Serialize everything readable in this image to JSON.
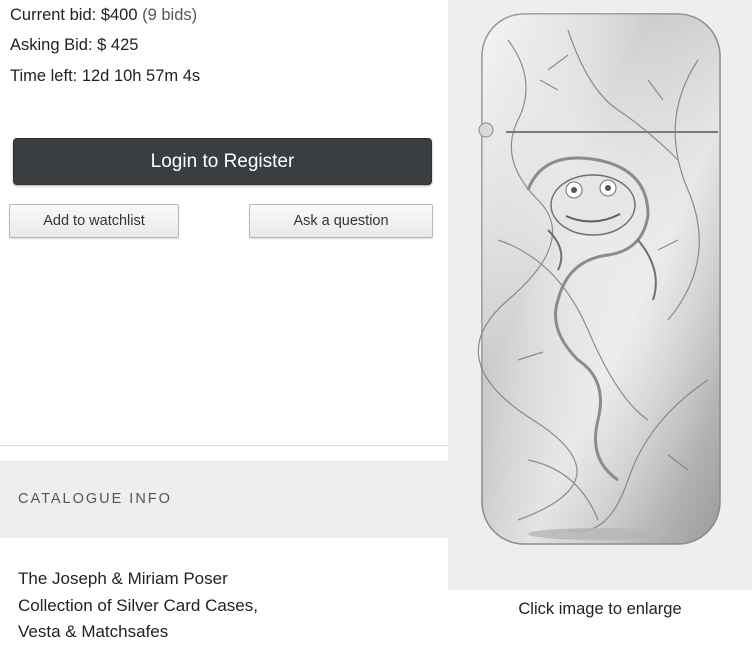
{
  "bidding": {
    "current_bid_label": "Current bid:",
    "current_bid_value": "$400",
    "current_bid_count": "(9 bids)",
    "asking_bid_label": "Asking Bid:",
    "asking_bid_value": "$ 425",
    "time_left_label": "Time left:",
    "time_left_value": "12d 10h 57m 4s"
  },
  "actions": {
    "register_label": "Login to Register",
    "watchlist_label": "Add to watchlist",
    "question_label": "Ask a question"
  },
  "catalogue": {
    "header": "CATALOGUE INFO",
    "collection_line1": "The Joseph & Miriam Poser",
    "collection_line2": "Collection of Silver Card Cases,",
    "collection_line3": "Vesta & Matchsafes"
  },
  "image": {
    "caption": "Click image to enlarge",
    "subject": "silver-vesta-case-with-frog-relief"
  },
  "colors": {
    "register_button_bg": "#3b3e40",
    "catalogue_header_bg": "#eeeeee",
    "image_bg": "#eeeeee"
  }
}
